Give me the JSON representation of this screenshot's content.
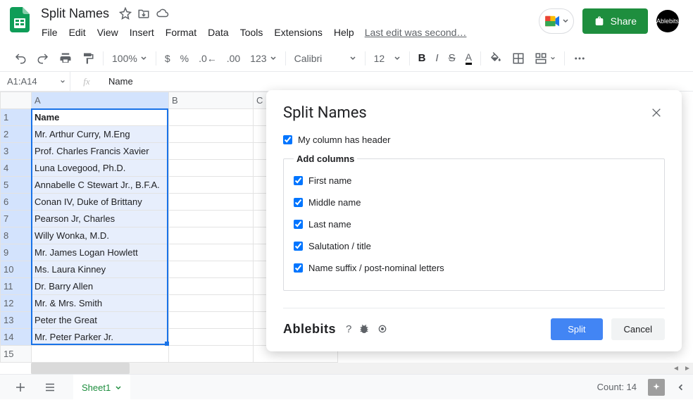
{
  "doc": {
    "title": "Split Names",
    "last_edit": "Last edit was second…"
  },
  "menubar": [
    "File",
    "Edit",
    "View",
    "Insert",
    "Format",
    "Data",
    "Tools",
    "Extensions",
    "Help"
  ],
  "toolbar": {
    "zoom": "100%",
    "number_format": "123",
    "font": "Calibri",
    "font_size": "12"
  },
  "share_label": "Share",
  "avatar_label": "Ablebits",
  "name_box": "A1:A14",
  "formula_value": "Name",
  "columns": [
    "A",
    "B",
    "C"
  ],
  "rows": [
    {
      "n": "1",
      "a": "Name",
      "header": true
    },
    {
      "n": "2",
      "a": "Mr. Arthur Curry, M.Eng"
    },
    {
      "n": "3",
      "a": "Prof. Charles Francis Xavier"
    },
    {
      "n": "4",
      "a": "Luna Lovegood, Ph.D."
    },
    {
      "n": "5",
      "a": "Annabelle C Stewart Jr., B.F.A."
    },
    {
      "n": "6",
      "a": "Conan IV, Duke of Brittany"
    },
    {
      "n": "7",
      "a": "Pearson Jr, Charles"
    },
    {
      "n": "8",
      "a": "Willy Wonka, M.D."
    },
    {
      "n": "9",
      "a": "Mr. James Logan Howlett"
    },
    {
      "n": "10",
      "a": "Ms. Laura Kinney"
    },
    {
      "n": "11",
      "a": "Dr. Barry Allen"
    },
    {
      "n": "12",
      "a": "Mr. & Mrs. Smith"
    },
    {
      "n": "13",
      "a": "Peter the Great"
    },
    {
      "n": "14",
      "a": "Mr. Peter Parker Jr."
    },
    {
      "n": "15",
      "a": ""
    }
  ],
  "dialog": {
    "title": "Split Names",
    "has_header_label": "My column has header",
    "fieldset_label": "Add columns",
    "options": [
      "First name",
      "Middle name",
      "Last name",
      "Salutation / title",
      "Name suffix / post-nominal letters"
    ],
    "brand": "Ablebits",
    "primary": "Split",
    "secondary": "Cancel"
  },
  "footer": {
    "sheet": "Sheet1",
    "count": "Count: 14"
  }
}
